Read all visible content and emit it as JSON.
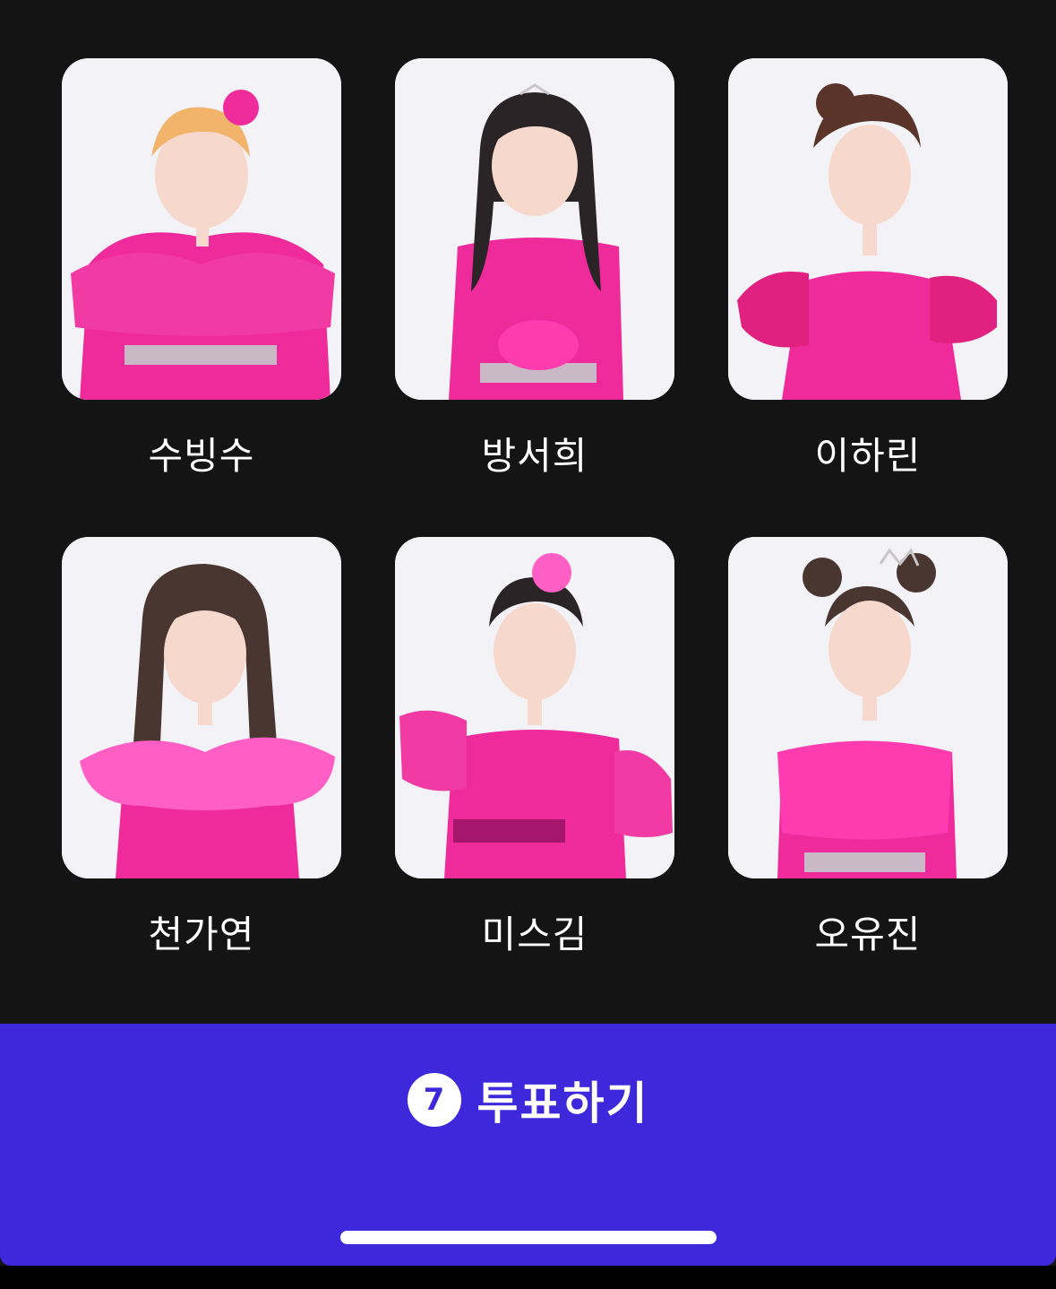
{
  "candidates": [
    {
      "name": "수빙수",
      "photo": "candidate-photo"
    },
    {
      "name": "방서희",
      "photo": "candidate-photo"
    },
    {
      "name": "이하린",
      "photo": "candidate-photo"
    },
    {
      "name": "천가연",
      "photo": "candidate-photo"
    },
    {
      "name": "미스김",
      "photo": "candidate-photo"
    },
    {
      "name": "오유진",
      "photo": "candidate-photo"
    }
  ],
  "vote": {
    "count": "7",
    "label": "투표하기"
  },
  "colors": {
    "background": "#141414",
    "accent": "#3d28dc",
    "card_bg": "#f3f2f6",
    "dress": "#ef2a9a",
    "text": "#ffffff"
  }
}
